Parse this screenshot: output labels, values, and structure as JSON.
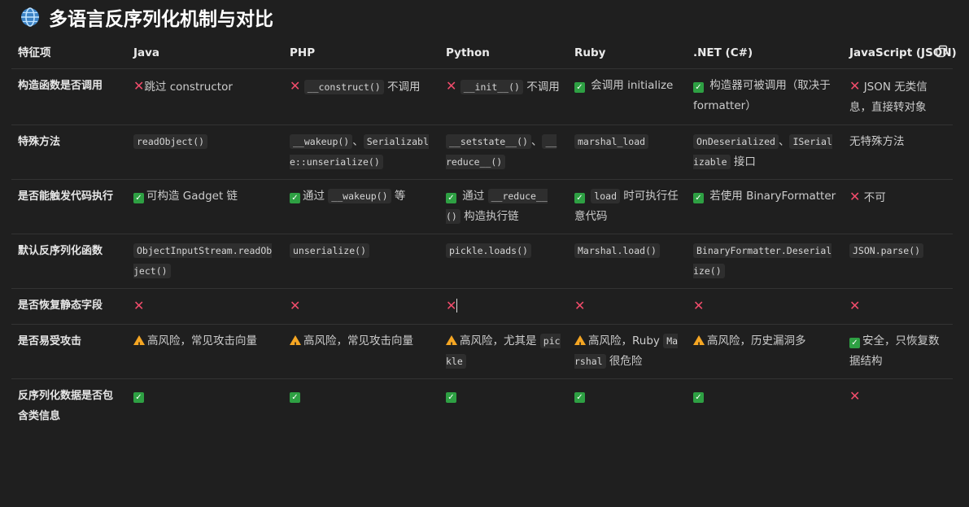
{
  "title": "多语言反序列化机制与对比",
  "icons": {
    "title_icon": "globe-icon",
    "yes": "check-icon",
    "no": "cross-icon",
    "warn": "warning-icon",
    "copy": "copy-icon"
  },
  "colors": {
    "background": "#1f1f1f",
    "check": "#2ea043",
    "cross": "#f14c6b",
    "warning": "#f5a623"
  },
  "table": {
    "headers": [
      "特征项",
      "Java",
      "PHP",
      "Python",
      "Ruby",
      ".NET (C#)",
      "JavaScript (JSON)"
    ],
    "rows": [
      {
        "feature": "构造函数是否调用",
        "cells": [
          [
            {
              "t": "no"
            },
            {
              "t": "text",
              "v": "跳过 constructor"
            }
          ],
          [
            {
              "t": "no"
            },
            {
              "t": "text",
              "v": " "
            },
            {
              "t": "code",
              "v": "__construct()"
            },
            {
              "t": "text",
              "v": " 不调用"
            }
          ],
          [
            {
              "t": "no"
            },
            {
              "t": "text",
              "v": " "
            },
            {
              "t": "code",
              "v": "__init__()"
            },
            {
              "t": "text",
              "v": " 不调用"
            }
          ],
          [
            {
              "t": "yes"
            },
            {
              "t": "text",
              "v": " 会调用 initialize"
            }
          ],
          [
            {
              "t": "yes"
            },
            {
              "t": "text",
              "v": " 构造器可被调用（取决于 formatter）"
            }
          ],
          [
            {
              "t": "no"
            },
            {
              "t": "text",
              "v": " JSON 无类信息，直接转对象"
            }
          ]
        ]
      },
      {
        "feature": "特殊方法",
        "cells": [
          [
            {
              "t": "code",
              "v": "readObject()"
            }
          ],
          [
            {
              "t": "code",
              "v": "__wakeup()"
            },
            {
              "t": "text",
              "v": "、"
            },
            {
              "t": "code",
              "v": "Serializable::unserialize()"
            }
          ],
          [
            {
              "t": "code",
              "v": "__setstate__()"
            },
            {
              "t": "text",
              "v": "、"
            },
            {
              "t": "code",
              "v": "__reduce__()"
            }
          ],
          [
            {
              "t": "code",
              "v": "marshal_load"
            }
          ],
          [
            {
              "t": "code",
              "v": "OnDeserialized"
            },
            {
              "t": "text",
              "v": "、"
            },
            {
              "t": "code",
              "v": "ISerializable"
            },
            {
              "t": "text",
              "v": " 接口"
            }
          ],
          [
            {
              "t": "text",
              "v": "无特殊方法"
            }
          ]
        ]
      },
      {
        "feature": "是否能触发代码执行",
        "cells": [
          [
            {
              "t": "yes"
            },
            {
              "t": "text",
              "v": "可构造 Gadget 链"
            }
          ],
          [
            {
              "t": "yes"
            },
            {
              "t": "text",
              "v": "通过 "
            },
            {
              "t": "code",
              "v": "__wakeup()"
            },
            {
              "t": "text",
              "v": " 等"
            }
          ],
          [
            {
              "t": "yes"
            },
            {
              "t": "text",
              "v": " 通过 "
            },
            {
              "t": "code",
              "v": "__reduce__()"
            },
            {
              "t": "text",
              "v": " 构造执行链"
            }
          ],
          [
            {
              "t": "yes"
            },
            {
              "t": "text",
              "v": " "
            },
            {
              "t": "code",
              "v": "load"
            },
            {
              "t": "text",
              "v": " 时可执行任意代码"
            }
          ],
          [
            {
              "t": "yes"
            },
            {
              "t": "text",
              "v": " 若使用 BinaryFormatter"
            }
          ],
          [
            {
              "t": "no"
            },
            {
              "t": "text",
              "v": " 不可"
            }
          ]
        ]
      },
      {
        "feature": "默认反序列化函数",
        "cells": [
          [
            {
              "t": "code",
              "v": "ObjectInputStream.readObject()"
            }
          ],
          [
            {
              "t": "code",
              "v": "unserialize()"
            }
          ],
          [
            {
              "t": "code",
              "v": "pickle.loads()"
            }
          ],
          [
            {
              "t": "code",
              "v": "Marshal.load()"
            }
          ],
          [
            {
              "t": "code",
              "v": "BinaryFormatter.Deserialize()"
            }
          ],
          [
            {
              "t": "code",
              "v": "JSON.parse()"
            }
          ]
        ]
      },
      {
        "feature": "是否恢复静态字段",
        "cells": [
          [
            {
              "t": "no"
            }
          ],
          [
            {
              "t": "no"
            }
          ],
          [
            {
              "t": "no"
            },
            {
              "t": "cursor"
            }
          ],
          [
            {
              "t": "no"
            }
          ],
          [
            {
              "t": "no"
            }
          ],
          [
            {
              "t": "no"
            }
          ]
        ]
      },
      {
        "feature": "是否易受攻击",
        "cells": [
          [
            {
              "t": "warn"
            },
            {
              "t": "text",
              "v": "高风险，常见攻击向量"
            }
          ],
          [
            {
              "t": "warn"
            },
            {
              "t": "text",
              "v": "高风险，常见攻击向量"
            }
          ],
          [
            {
              "t": "warn"
            },
            {
              "t": "text",
              "v": "高风险，尤其是 "
            },
            {
              "t": "code",
              "v": "pickle"
            }
          ],
          [
            {
              "t": "warn"
            },
            {
              "t": "text",
              "v": "高风险，Ruby "
            },
            {
              "t": "code",
              "v": "Marshal"
            },
            {
              "t": "text",
              "v": " 很危险"
            }
          ],
          [
            {
              "t": "warn"
            },
            {
              "t": "text",
              "v": "高风险，历史漏洞多"
            }
          ],
          [
            {
              "t": "yes"
            },
            {
              "t": "text",
              "v": "安全，只恢复数据结构"
            }
          ]
        ]
      },
      {
        "feature": "反序列化数据是否包含类信息",
        "cells": [
          [
            {
              "t": "yes"
            }
          ],
          [
            {
              "t": "yes"
            }
          ],
          [
            {
              "t": "yes"
            }
          ],
          [
            {
              "t": "yes"
            }
          ],
          [
            {
              "t": "yes"
            }
          ],
          [
            {
              "t": "no"
            }
          ]
        ]
      }
    ]
  }
}
